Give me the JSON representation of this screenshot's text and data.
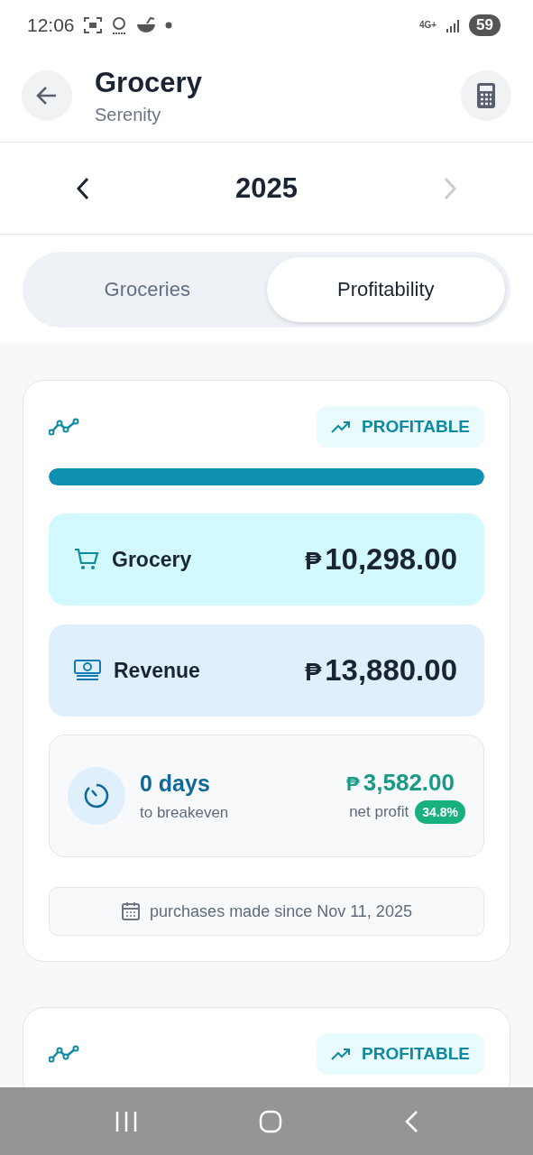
{
  "status_bar": {
    "time": "12:06",
    "network": "4G+",
    "battery": "59"
  },
  "header": {
    "title": "Grocery",
    "subtitle": "Serenity"
  },
  "year_nav": {
    "year": "2025",
    "prev_disabled": false,
    "next_disabled": true
  },
  "tabs": [
    {
      "label": "Groceries",
      "selected": false
    },
    {
      "label": "Profitability",
      "selected": true
    }
  ],
  "cards": [
    {
      "status": "PROFITABLE",
      "level": 1,
      "rows": [
        {
          "kind": "cost",
          "label": "Grocery",
          "currency": "₱",
          "amount": "10,298.00"
        },
        {
          "kind": "revenue",
          "label": "Revenue",
          "currency": "₱",
          "amount": "13,880.00"
        }
      ],
      "breakeven": {
        "value": "0 days",
        "caption": "to breakeven"
      },
      "profit": {
        "currency": "₱",
        "amount": "3,582.00",
        "caption": "net profit",
        "percent": "34.8%"
      },
      "note": "purchases made since Nov 11, 2025"
    },
    {
      "status": "PROFITABLE"
    }
  ]
}
